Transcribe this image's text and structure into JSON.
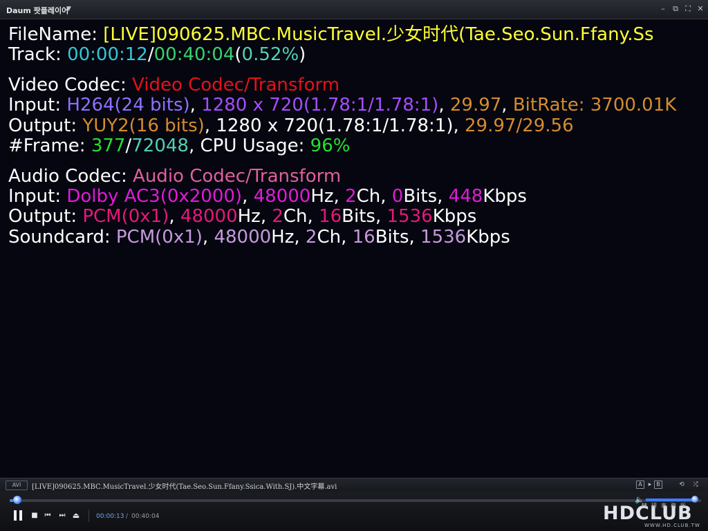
{
  "window": {
    "title": "Daum 팟플레이어",
    "menu_caret": "▼",
    "buttons": {
      "minimize": "–",
      "restore": "⧉",
      "fullscreen": "⛶",
      "close": "✕"
    }
  },
  "osd": {
    "file": {
      "label": "FileName: ",
      "value": "[LIVE]090625.MBC.MusicTravel.少女时代(Tae.Seo.Sun.Ffany.Ss"
    },
    "track": {
      "label": "Track: ",
      "current": "00:00:12",
      "sep": "/",
      "total": "00:40:04",
      "percent": "(0.52%)",
      "pct_open": "(",
      "pct_value": "0.52%",
      "pct_close": ")"
    },
    "video": {
      "codec_label": "Video Codec: ",
      "codec_value": "Video Codec/Transform",
      "input_label": "Input: ",
      "input_format": "H264(24 bits)",
      "input_res": "1280 x 720(1.78:1/1.78:1)",
      "input_fps": "29.97",
      "bitrate_label": "BitRate: ",
      "bitrate_value": "3700.01K",
      "output_label": "Output: ",
      "output_format": "YUY2(16 bits)",
      "output_res": "1280 x 720(1.78:1/1.78:1)",
      "output_fps": "29.97/29.56",
      "frame_label": "#Frame: ",
      "frame_current": "377",
      "frame_sep": "/",
      "frame_total": "72048",
      "cpu_label": "CPU Usage: ",
      "cpu_value": "96%"
    },
    "audio": {
      "codec_label": "Audio Codec: ",
      "codec_value": "Audio Codec/Transform",
      "input_label": "Input: ",
      "input_format": "Dolby AC3(0x2000)",
      "input_hz": "48000",
      "input_ch": "2",
      "input_bits": "0",
      "input_kbps": "448",
      "output_label": "Output: ",
      "output_format": "PCM(0x1)",
      "output_hz": "48000",
      "output_ch": "2",
      "output_bits": "16",
      "output_kbps": "1536",
      "sound_label": "Soundcard: ",
      "sound_format": "PCM(0x1)",
      "sound_hz": "48000",
      "sound_ch": "2",
      "sound_bits": "16",
      "sound_kbps": "1536",
      "unit_hz": "Hz",
      "unit_ch": "Ch",
      "unit_bits": "Bits",
      "unit_kbps": "Kbps",
      "comma": ", "
    }
  },
  "filebar": {
    "format_badge": "AVI",
    "filename": "[LIVE]090625.MBC.MusicTravel.少女时代(Tae.Seo.Sun.Ffany.Ssica.With.SJ).中文字幕.avi",
    "icons": {
      "a": "A",
      "arrow": "▸",
      "b": "B",
      "repeat": "⟲",
      "shuffle": "⤮"
    }
  },
  "controls": {
    "seek_progress_percent": 0.52,
    "volume_percent": 95,
    "time_current": "00:00:13",
    "time_sep": "/",
    "time_total": "00:40:04",
    "stop": "■",
    "prev": "⏮",
    "next": "⏭",
    "eject": "⏏",
    "volume_icon": "🔈"
  },
  "watermark": {
    "main": "HDCLUB",
    "sub": "精研事務所",
    "url": "WWW.HD.CLUB.TW"
  }
}
